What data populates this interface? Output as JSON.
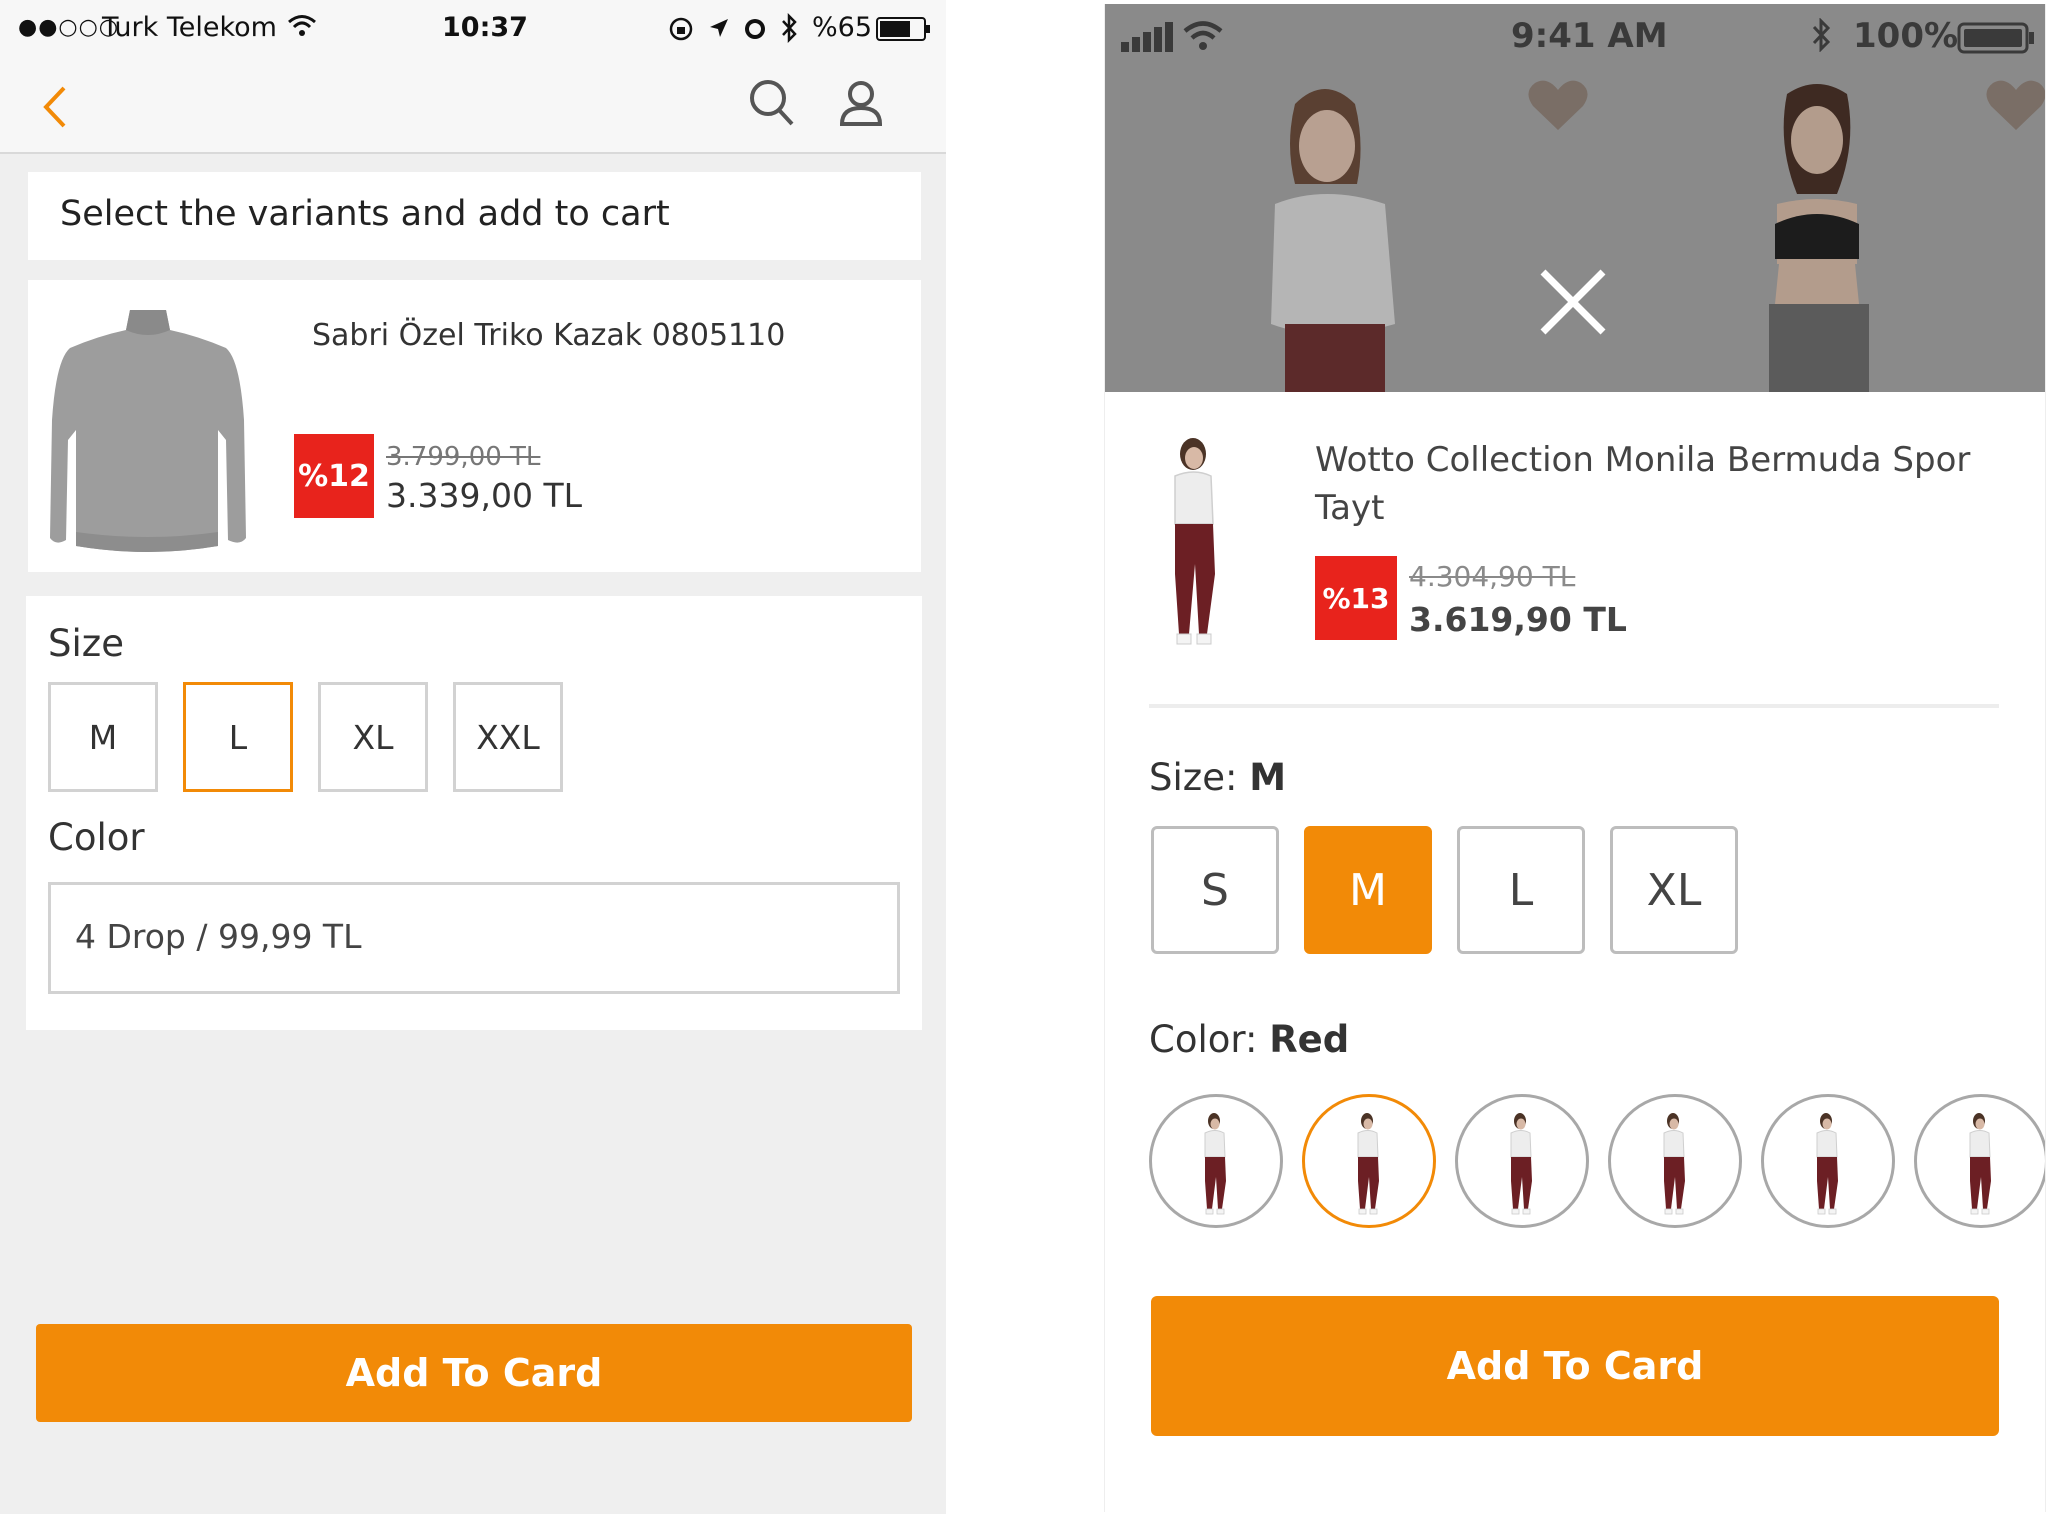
{
  "left_screen": {
    "status_bar": {
      "signal": "●●○○○",
      "carrier": "Turk Telekom",
      "time": "10:37",
      "battery": "%65"
    },
    "header_text": "Select the variants and add to cart",
    "product": {
      "name": "Sabri Özel Triko Kazak 0805110",
      "discount_badge": "%12",
      "old_price": "3.799,00 TL",
      "price": "3.339,00 TL"
    },
    "size": {
      "label": "Size",
      "options": [
        "M",
        "L",
        "XL",
        "XXL"
      ],
      "selected": "L"
    },
    "color": {
      "label": "Color",
      "value": "4 Drop / 99,99 TL"
    },
    "add_button": "Add To Card"
  },
  "right_screen": {
    "status_bar": {
      "time": "9:41 AM",
      "battery": "100%"
    },
    "product": {
      "name_line1": "Wotto Collection Monila Bermuda Spor",
      "name_line2": "Tayt",
      "discount_badge": "%13",
      "old_price": "4.304,90 TL",
      "price": "3.619,90 TL"
    },
    "size": {
      "label": "Size:",
      "selected_value": "M",
      "options": [
        "S",
        "M",
        "L",
        "XL"
      ],
      "selected": "M"
    },
    "color": {
      "label": "Color:",
      "selected_value": "Red",
      "swatch_count": 6,
      "selected_index": 1
    },
    "add_button": "Add To Card"
  },
  "colors": {
    "accent_orange": "#f28a07",
    "discount_red": "#e8231c",
    "overlay_gray": "#8a8a8a"
  }
}
